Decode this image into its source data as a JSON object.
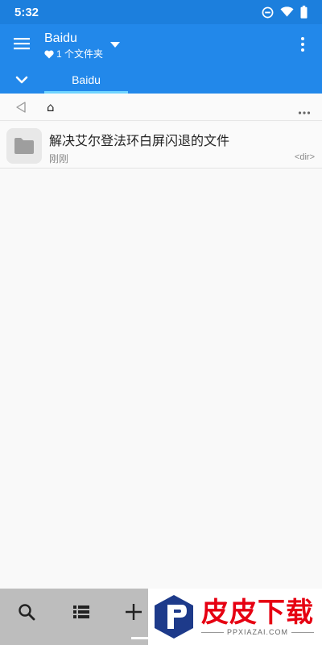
{
  "status_bar": {
    "time": "5:32",
    "icons": [
      "do-not-disturb-icon",
      "wifi-icon",
      "battery-icon"
    ]
  },
  "app_bar": {
    "title": "Baidu",
    "subtitle": "1 个文件夹",
    "subtitle_icon": "heart-icon",
    "tabs": [
      {
        "label": "Baidu",
        "active": true
      }
    ],
    "colors": {
      "primary": "#2288ea",
      "status": "#1c7fdd",
      "indicator": "#6fd4ff"
    }
  },
  "path_bar": {
    "home_glyph": "⌂"
  },
  "files": [
    {
      "name": "解决艾尔登法环白屏闪退的文件",
      "time": "刚刚",
      "meta": "<dir>",
      "icon": "folder-icon"
    }
  ],
  "bottom_bar": {
    "buttons": [
      "search-icon",
      "list-view-icon",
      "add-icon"
    ]
  },
  "watermark": {
    "main": "皮皮下载",
    "sub": "PPXIAZAI.COM"
  }
}
